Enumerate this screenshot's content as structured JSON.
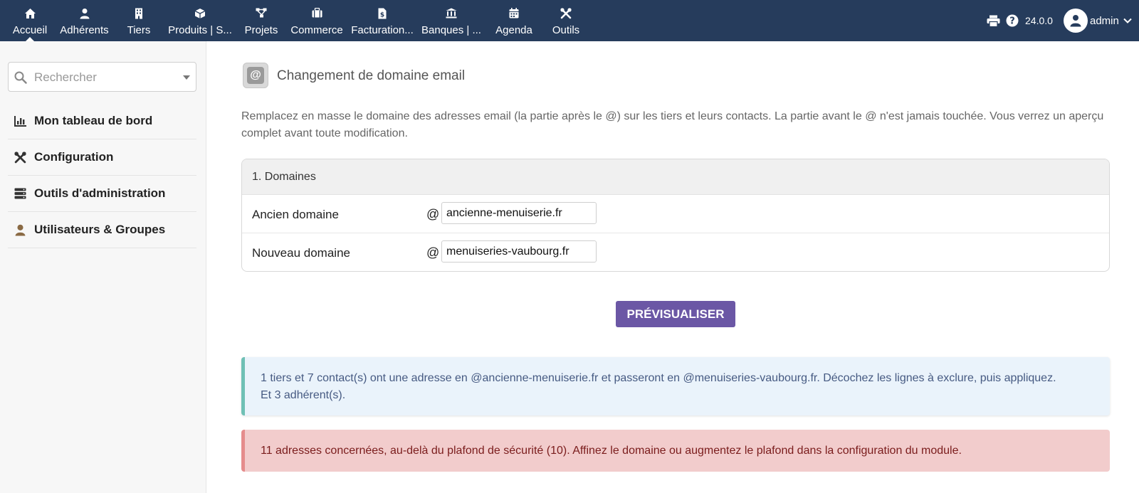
{
  "topnav": {
    "items": [
      {
        "label": "Accueil",
        "icon": "home-icon"
      },
      {
        "label": "Adhérents",
        "icon": "user-icon"
      },
      {
        "label": "Tiers",
        "icon": "building-icon"
      },
      {
        "label": "Produits | S...",
        "icon": "cube-icon"
      },
      {
        "label": "Projets",
        "icon": "sitemap-icon"
      },
      {
        "label": "Commerce",
        "icon": "briefcase-icon"
      },
      {
        "label": "Facturation...",
        "icon": "invoice-icon"
      },
      {
        "label": "Banques | ...",
        "icon": "bank-icon"
      },
      {
        "label": "Agenda",
        "icon": "calendar-icon"
      },
      {
        "label": "Outils",
        "icon": "tools-icon"
      }
    ],
    "active": "Accueil",
    "version": "24.0.0",
    "user": "admin"
  },
  "sidebar": {
    "search_placeholder": "Rechercher",
    "items": [
      {
        "label": "Mon tableau de bord",
        "icon": "chart-icon"
      },
      {
        "label": "Configuration",
        "icon": "tools-icon"
      },
      {
        "label": "Outils d'administration",
        "icon": "server-icon"
      },
      {
        "label": "Utilisateurs & Groupes",
        "icon": "user-icon"
      }
    ]
  },
  "main": {
    "title": "Changement de domaine email",
    "intro": "Remplacez en masse le domaine des adresses email (la partie après le @) sur les tiers et leurs contacts. La partie avant le @ n'est jamais touchée. Vous verrez un aperçu complet avant toute modification.",
    "panel": {
      "heading": "1. Domaines",
      "at_symbol": "@",
      "old_label": "Ancien domaine",
      "old_value": "ancienne-menuiserie.fr",
      "new_label": "Nouveau domaine",
      "new_value": "menuiseries-vaubourg.fr"
    },
    "preview_button": "PRÉVISUALISER",
    "info_alert_line1": "1 tiers et 7 contact(s) ont une adresse en @ancienne-menuiserie.fr et passeront en @menuiseries-vaubourg.fr. Décochez les lignes à exclure, puis appliquez.",
    "info_alert_line2": "Et 3 adhérent(s).",
    "danger_alert": "11 adresses concernées, au-delà du plafond de sécurité (10). Affinez le domaine ou augmentez le plafond dans la configuration du module."
  },
  "colors": {
    "topbar": "#263c5c",
    "primary_button": "#6b57a5",
    "info_bg": "#eaf3fb",
    "info_border": "#6fc0b5",
    "danger_bg": "#f2cccc",
    "danger_border": "#e58c8c"
  }
}
